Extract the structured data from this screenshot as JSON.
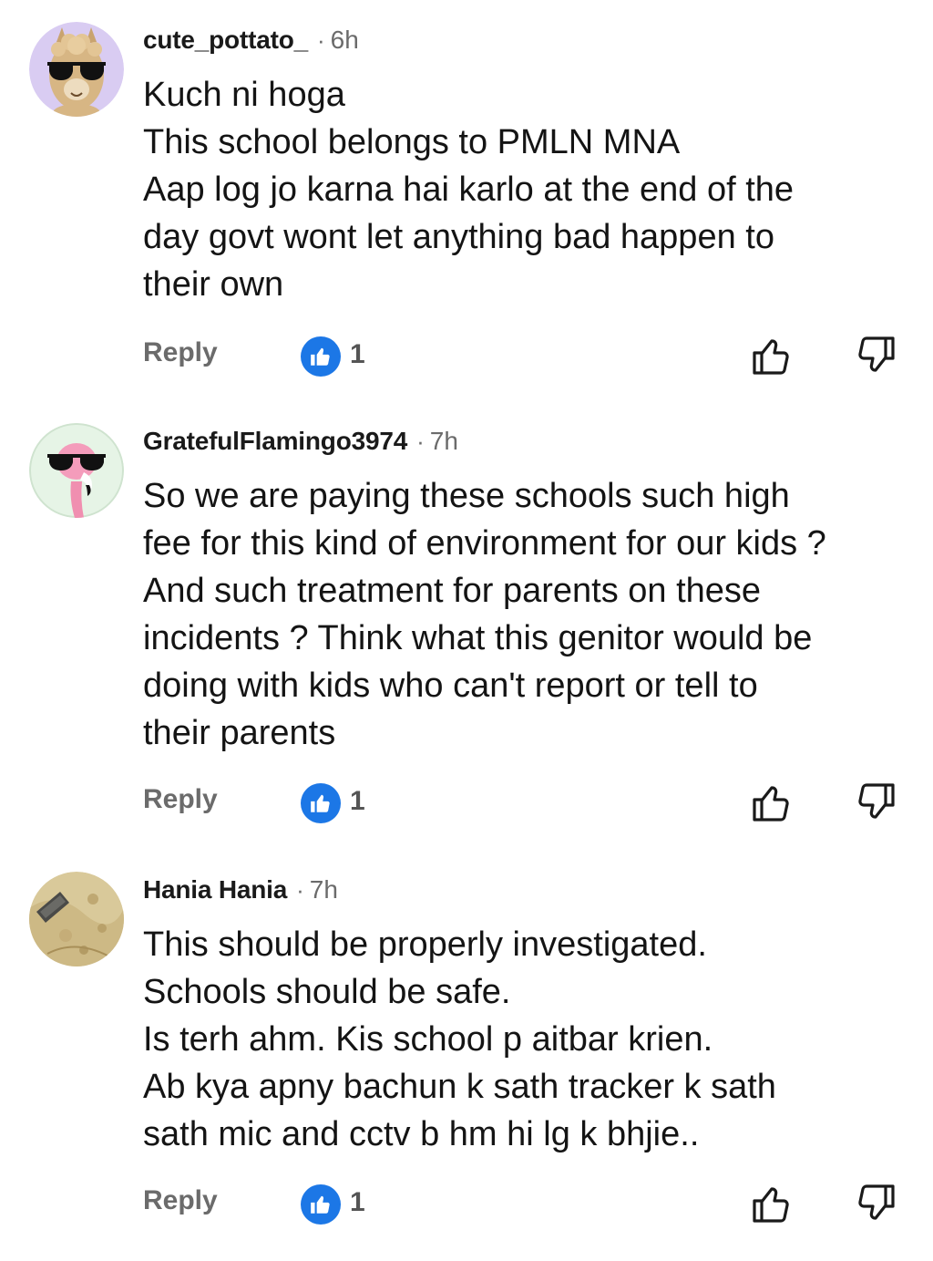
{
  "comments": [
    {
      "username": "cute_pottato_",
      "separator": "·",
      "time": "6h",
      "avatar_icon": "alpaca-sunglasses-avatar",
      "lines": [
        "Kuch ni hoga",
        "This school belongs to PMLN MNA",
        "Aap log jo karna hai karlo at the end of the",
        "day govt wont let anything bad happen to",
        "their own"
      ],
      "reply_label": "Reply",
      "like_count": "1"
    },
    {
      "username": "GratefulFlamingo3974",
      "separator": "·",
      "time": "7h",
      "avatar_icon": "flamingo-sunglasses-avatar",
      "lines": [
        "So we are paying these schools such high",
        "fee for this kind of environment for our kids ?",
        "And such treatment for parents on these",
        "incidents ? Think what this genitor would be",
        "doing with kids who can't report or tell to",
        "their parents"
      ],
      "reply_label": "Reply",
      "like_count": "1"
    },
    {
      "username": "Hania Hania",
      "separator": "·",
      "time": "7h",
      "avatar_icon": "photo-avatar",
      "lines": [
        "This should be properly investigated.",
        "Schools should be safe.",
        "Is terh ahm. Kis school p aitbar krien.",
        "Ab kya apny bachun k sath tracker k sath",
        "sath mic and cctv b hm hi lg k bhjie.."
      ],
      "reply_label": "Reply",
      "like_count": "1"
    }
  ],
  "colors": {
    "like_badge": "#1c77e6",
    "muted_text": "#6b6b6b",
    "alpaca_bg": "#d9ccf2",
    "flamingo_bg": "#e6f4e6"
  }
}
